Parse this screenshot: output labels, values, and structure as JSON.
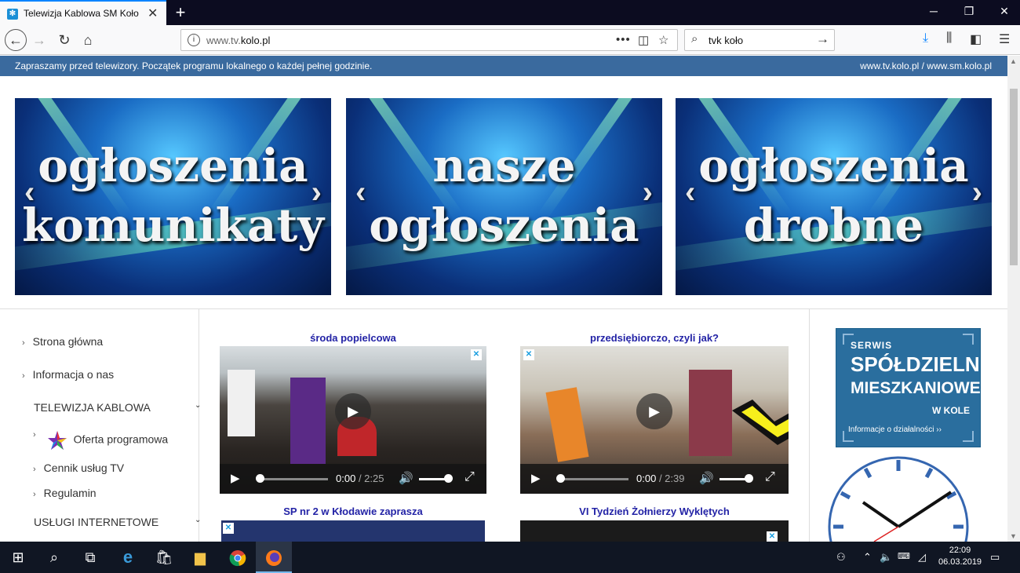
{
  "browser": {
    "tab_title": "Telewizja Kablowa SM Koło",
    "url_prefix": "www.tv.",
    "url_domain": "kolo.pl",
    "search_query": "tvk koło"
  },
  "notice": {
    "left_text": "Zapraszamy przed telewizory. Początek programu lokalnego o każdej pełnej godzinie.",
    "right_text": "www.tv.kolo.pl  /  www.sm.kolo.pl"
  },
  "banners": [
    {
      "line1": "ogłoszenia",
      "line2": "komunikaty"
    },
    {
      "line1": "nasze",
      "line2": "ogłoszenia"
    },
    {
      "line1": "ogłoszenia",
      "line2": "drobne"
    }
  ],
  "sidebar": {
    "items": [
      {
        "label": "Strona główna"
      },
      {
        "label": "Informacja o nas"
      }
    ],
    "section_tv": "TELEWIZJA KABLOWA",
    "sub_items": [
      {
        "label": "Oferta programowa"
      },
      {
        "label": "Cennik usług TV"
      },
      {
        "label": "Regulamin"
      }
    ],
    "section_internet": "USŁUGI INTERNETOWE"
  },
  "videos": [
    {
      "title": "środa popielcowa",
      "current": "0:00",
      "duration": "2:25"
    },
    {
      "title": "przedsiębiorczo, czyli jak?",
      "current": "0:00",
      "duration": "2:39"
    },
    {
      "title": "SP nr 2 w Kłodawie zaprasza"
    },
    {
      "title": "VI Tydzień Żołnierzy Wyklętych"
    }
  ],
  "serwis": {
    "line1": "SERWIS",
    "line2": "SPÓŁDZIELNI",
    "line3": "MIESZKANIOWEJ",
    "line4": "W KOLE",
    "line5": "Informacje o działalności"
  },
  "taskbar": {
    "time": "22:09",
    "date": "06.03.2019"
  }
}
